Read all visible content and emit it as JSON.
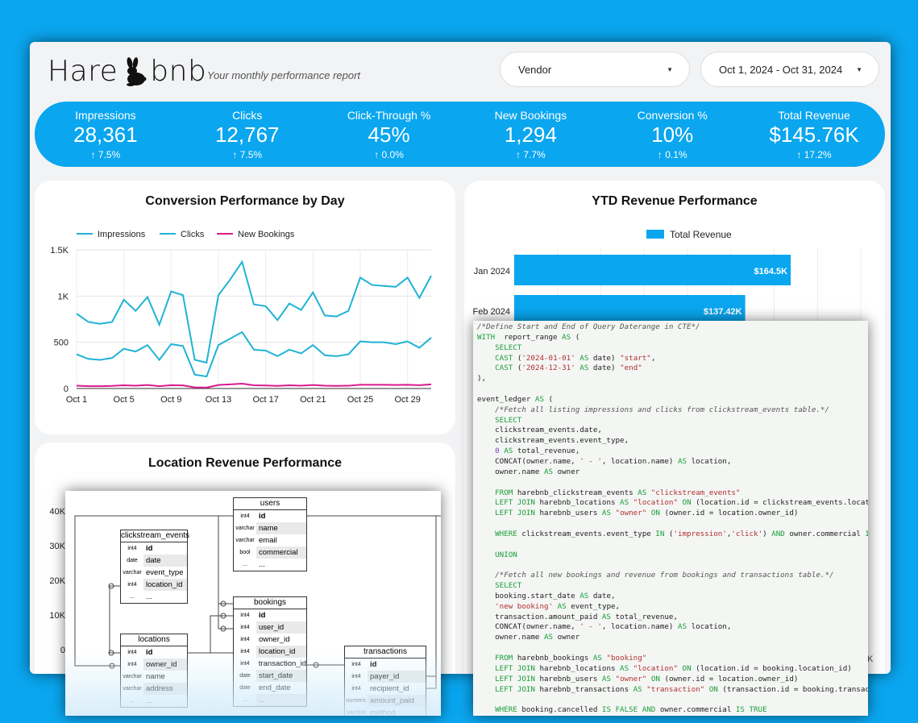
{
  "brand": {
    "part1": "Hare",
    "part2": "bnb",
    "tagline": "Your monthly performance report"
  },
  "filters": {
    "vendor": "Vendor",
    "date_range": "Oct 1, 2024 - Oct 31, 2024"
  },
  "kpis": [
    {
      "label": "Impressions",
      "value": "28,361",
      "change": "7.5%"
    },
    {
      "label": "Clicks",
      "value": "12,767",
      "change": "7.5%"
    },
    {
      "label": "Click-Through %",
      "value": "45%",
      "change": "0.0%"
    },
    {
      "label": "New Bookings",
      "value": "1,294",
      "change": "7.7%"
    },
    {
      "label": "Conversion %",
      "value": "10%",
      "change": "0.1%"
    },
    {
      "label": "Total Revenue",
      "value": "$145.76K",
      "change": "17.2%"
    }
  ],
  "colors": {
    "accent": "#0aa6ef",
    "impressions": "#1fb3d6",
    "clicks": "#1fb3d6",
    "bookings": "#d81b8c"
  },
  "chart_data": [
    {
      "type": "line",
      "title": "Conversion Performance by Day",
      "x": [
        1,
        2,
        3,
        4,
        5,
        6,
        7,
        8,
        9,
        10,
        11,
        12,
        13,
        14,
        15,
        16,
        17,
        18,
        19,
        20,
        21,
        22,
        23,
        24,
        25,
        26,
        27,
        28,
        29,
        30,
        31
      ],
      "xticks": [
        "Oct 1",
        "Oct 5",
        "Oct 9",
        "Oct 13",
        "Oct 17",
        "Oct 21",
        "Oct 25",
        "Oct 29"
      ],
      "yticks": [
        "0",
        "500",
        "1K",
        "1.5K"
      ],
      "ylim": [
        0,
        1500
      ],
      "legend": "top",
      "series": [
        {
          "name": "Impressions",
          "values": [
            810,
            720,
            700,
            720,
            960,
            840,
            990,
            690,
            1050,
            1010,
            310,
            280,
            1010,
            1180,
            1370,
            910,
            890,
            740,
            920,
            850,
            1040,
            790,
            780,
            840,
            1200,
            1120,
            1110,
            1100,
            1200,
            980,
            1220
          ]
        },
        {
          "name": "Clicks",
          "values": [
            370,
            320,
            310,
            330,
            430,
            400,
            470,
            310,
            480,
            460,
            150,
            130,
            470,
            540,
            610,
            420,
            410,
            350,
            420,
            380,
            470,
            360,
            350,
            370,
            510,
            500,
            500,
            480,
            510,
            440,
            550
          ]
        },
        {
          "name": "New Bookings",
          "values": [
            30,
            25,
            25,
            28,
            35,
            30,
            38,
            25,
            36,
            34,
            12,
            10,
            38,
            45,
            52,
            35,
            33,
            28,
            35,
            30,
            38,
            30,
            28,
            30,
            40,
            40,
            40,
            38,
            40,
            36,
            45
          ]
        }
      ]
    },
    {
      "type": "bar",
      "title": "YTD Revenue Performance",
      "legend": "top",
      "orientation": "horizontal",
      "categories": [
        "Jan 2024",
        "Feb 2024"
      ],
      "series": [
        {
          "name": "Total Revenue",
          "values": [
            164.5,
            137.42
          ],
          "labels": [
            "$164.5K",
            "$137.42K"
          ]
        }
      ],
      "xlim": [
        0,
        200
      ]
    },
    {
      "type": "bar",
      "title": "Location Revenue Performance",
      "yticks": [
        "0",
        "10K",
        "20K",
        "30K",
        "40K"
      ]
    }
  ],
  "sql_lines": [
    [
      [
        "cm",
        "/*Define Start and End of Query Daterange in CTE*/"
      ]
    ],
    [
      [
        "kw",
        "WITH"
      ],
      [
        "",
        "  report_range "
      ],
      [
        "kw",
        "AS"
      ],
      [
        "",
        " ("
      ]
    ],
    [
      [
        "",
        ""
      ],
      [
        "kw",
        "    SELECT"
      ]
    ],
    [
      [
        "",
        "    "
      ],
      [
        "kw",
        "CAST"
      ],
      [
        "",
        " ("
      ],
      [
        "st",
        "'2024-01-01'"
      ],
      [
        "",
        " "
      ],
      [
        "kw",
        "AS"
      ],
      [
        "",
        " date) "
      ],
      [
        "st",
        "\"start\""
      ],
      [
        "",
        ","
      ]
    ],
    [
      [
        "",
        "    "
      ],
      [
        "kw",
        "CAST"
      ],
      [
        "",
        " ("
      ],
      [
        "st",
        "'2024-12-31'"
      ],
      [
        "",
        " "
      ],
      [
        "kw",
        "AS"
      ],
      [
        "",
        " date) "
      ],
      [
        "st",
        "\"end\""
      ]
    ],
    [
      [
        "",
        "),"
      ]
    ],
    [
      [
        "",
        ""
      ]
    ],
    [
      [
        "",
        "event_ledger "
      ],
      [
        "kw",
        "AS"
      ],
      [
        "",
        " ("
      ]
    ],
    [
      [
        "",
        "    "
      ],
      [
        "cm",
        "/*Fetch all listing impressions and clicks from clickstream_events table.*/"
      ]
    ],
    [
      [
        "",
        "    "
      ],
      [
        "kw",
        "SELECT"
      ]
    ],
    [
      [
        "",
        "    clickstream_events.date,"
      ]
    ],
    [
      [
        "",
        "    clickstream_events.event_type,"
      ]
    ],
    [
      [
        "",
        "    "
      ],
      [
        "nu",
        "0"
      ],
      [
        "",
        " "
      ],
      [
        "kw",
        "AS"
      ],
      [
        "",
        " total_revenue,"
      ]
    ],
    [
      [
        "",
        "    CONCAT(owner.name, "
      ],
      [
        "st",
        "' - '"
      ],
      [
        "",
        ", location.name) "
      ],
      [
        "kw",
        "AS"
      ],
      [
        "",
        " location,"
      ]
    ],
    [
      [
        "",
        "    owner.name "
      ],
      [
        "kw",
        "AS"
      ],
      [
        "",
        " owner"
      ]
    ],
    [
      [
        "",
        ""
      ]
    ],
    [
      [
        "",
        "    "
      ],
      [
        "kw",
        "FROM"
      ],
      [
        "",
        " harebnb_clickstream_events "
      ],
      [
        "kw",
        "AS"
      ],
      [
        "",
        " "
      ],
      [
        "st",
        "\"clickstream_events\""
      ]
    ],
    [
      [
        "",
        "    "
      ],
      [
        "kw",
        "LEFT JOIN"
      ],
      [
        "",
        " harebnb_locations "
      ],
      [
        "kw",
        "AS"
      ],
      [
        "",
        " "
      ],
      [
        "st",
        "\"location\""
      ],
      [
        "",
        " "
      ],
      [
        "kw",
        "ON"
      ],
      [
        "",
        " (location.id = clickstream_events.location_id)"
      ]
    ],
    [
      [
        "",
        "    "
      ],
      [
        "kw",
        "LEFT JOIN"
      ],
      [
        "",
        " harebnb_users "
      ],
      [
        "kw",
        "AS"
      ],
      [
        "",
        " "
      ],
      [
        "st",
        "\"owner\""
      ],
      [
        "",
        " "
      ],
      [
        "kw",
        "ON"
      ],
      [
        "",
        " (owner.id = location.owner_id)"
      ]
    ],
    [
      [
        "",
        ""
      ]
    ],
    [
      [
        "",
        "    "
      ],
      [
        "kw",
        "WHERE"
      ],
      [
        "",
        " clickstream_events.event_type "
      ],
      [
        "kw",
        "IN"
      ],
      [
        "",
        " ("
      ],
      [
        "st",
        "'impression'"
      ],
      [
        "",
        ","
      ],
      [
        "st",
        "'click'"
      ],
      [
        "",
        ") "
      ],
      [
        "kw",
        "AND"
      ],
      [
        "",
        " owner.commercial "
      ],
      [
        "kw",
        "IS TRUE"
      ]
    ],
    [
      [
        "",
        ""
      ]
    ],
    [
      [
        "",
        "    "
      ],
      [
        "kw",
        "UNION"
      ]
    ],
    [
      [
        "",
        ""
      ]
    ],
    [
      [
        "",
        "    "
      ],
      [
        "cm",
        "/*Fetch all new bookings and revenue from bookings and transactions table.*/"
      ]
    ],
    [
      [
        "",
        "    "
      ],
      [
        "kw",
        "SELECT"
      ]
    ],
    [
      [
        "",
        "    booking.start_date "
      ],
      [
        "kw",
        "AS"
      ],
      [
        "",
        " date,"
      ]
    ],
    [
      [
        "",
        "    "
      ],
      [
        "st",
        "'new booking'"
      ],
      [
        "",
        " "
      ],
      [
        "kw",
        "AS"
      ],
      [
        "",
        " event_type,"
      ]
    ],
    [
      [
        "",
        "    transaction.amount_paid "
      ],
      [
        "kw",
        "AS"
      ],
      [
        "",
        " total_revenue,"
      ]
    ],
    [
      [
        "",
        "    CONCAT(owner.name, "
      ],
      [
        "st",
        "' - '"
      ],
      [
        "",
        ", location.name) "
      ],
      [
        "kw",
        "AS"
      ],
      [
        "",
        " location,"
      ]
    ],
    [
      [
        "",
        "    owner.name "
      ],
      [
        "kw",
        "AS"
      ],
      [
        "",
        " owner"
      ]
    ],
    [
      [
        "",
        ""
      ]
    ],
    [
      [
        "",
        "    "
      ],
      [
        "kw",
        "FROM"
      ],
      [
        "",
        " harebnb_bookings "
      ],
      [
        "kw",
        "AS"
      ],
      [
        "",
        " "
      ],
      [
        "st",
        "\"booking\""
      ]
    ],
    [
      [
        "",
        "    "
      ],
      [
        "kw",
        "LEFT JOIN"
      ],
      [
        "",
        " harebnb_locations "
      ],
      [
        "kw",
        "AS"
      ],
      [
        "",
        " "
      ],
      [
        "st",
        "\"location\""
      ],
      [
        "",
        " "
      ],
      [
        "kw",
        "ON"
      ],
      [
        "",
        " (location.id = booking.location_id)"
      ]
    ],
    [
      [
        "",
        "    "
      ],
      [
        "kw",
        "LEFT JOIN"
      ],
      [
        "",
        " harebnb_users "
      ],
      [
        "kw",
        "AS"
      ],
      [
        "",
        " "
      ],
      [
        "st",
        "\"owner\""
      ],
      [
        "",
        " "
      ],
      [
        "kw",
        "ON"
      ],
      [
        "",
        " (owner.id = location.owner_id)"
      ]
    ],
    [
      [
        "",
        "    "
      ],
      [
        "kw",
        "LEFT JOIN"
      ],
      [
        "",
        " harebnb_transactions "
      ],
      [
        "kw",
        "AS"
      ],
      [
        "",
        " "
      ],
      [
        "st",
        "\"transaction\""
      ],
      [
        "",
        " "
      ],
      [
        "kw",
        "ON"
      ],
      [
        "",
        " (transaction.id = booking.transaction_id)"
      ]
    ],
    [
      [
        "",
        ""
      ]
    ],
    [
      [
        "",
        "    "
      ],
      [
        "kw",
        "WHERE"
      ],
      [
        "",
        " booking.cancelled "
      ],
      [
        "kw",
        "IS FALSE AND"
      ],
      [
        "",
        " owner.commercial "
      ],
      [
        "kw",
        "IS TRUE"
      ]
    ]
  ],
  "erd_tables": [
    {
      "name": "users",
      "rows": [
        [
          "int4",
          "id"
        ],
        [
          "varchar",
          "name"
        ],
        [
          "varchar",
          "email"
        ],
        [
          "bool",
          "commercial"
        ],
        [
          "...",
          "..."
        ]
      ]
    },
    {
      "name": "clickstream_events",
      "rows": [
        [
          "int4",
          "id"
        ],
        [
          "date",
          "date"
        ],
        [
          "varchar",
          "event_type"
        ],
        [
          "int4",
          "location_id"
        ],
        [
          "...",
          "..."
        ]
      ]
    },
    {
      "name": "bookings",
      "rows": [
        [
          "int4",
          "id"
        ],
        [
          "int4",
          "user_id"
        ],
        [
          "int4",
          "owner_id"
        ],
        [
          "int4",
          "location_id"
        ],
        [
          "int4",
          "transaction_id"
        ],
        [
          "date",
          "start_date"
        ],
        [
          "date",
          "end_date"
        ],
        [
          "...",
          "..."
        ]
      ]
    },
    {
      "name": "locations",
      "rows": [
        [
          "int4",
          "id"
        ],
        [
          "int4",
          "owner_id"
        ],
        [
          "varchar",
          "name"
        ],
        [
          "varchar",
          "address"
        ],
        [
          "...",
          "..."
        ]
      ]
    },
    {
      "name": "transactions",
      "rows": [
        [
          "int4",
          "id"
        ],
        [
          "int4",
          "payer_id"
        ],
        [
          "int4",
          "recipient_id"
        ],
        [
          "numeric",
          "amount_paid"
        ],
        [
          "varchar",
          "method"
        ]
      ]
    }
  ],
  "hidden_axis_label": "K"
}
